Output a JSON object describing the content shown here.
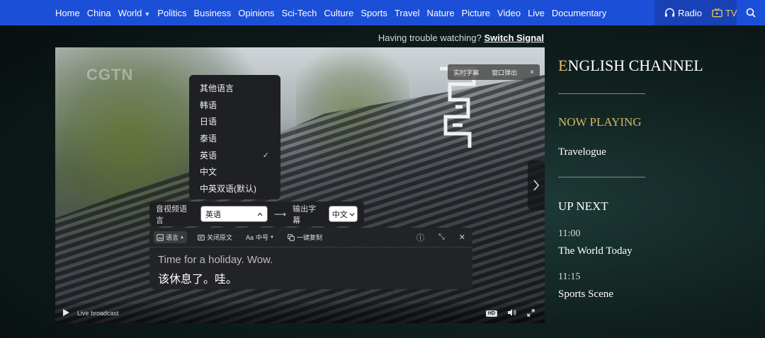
{
  "nav": {
    "items": [
      "Home",
      "China",
      "World",
      "Politics",
      "Business",
      "Opinions",
      "Sci-Tech",
      "Culture",
      "Sports",
      "Travel",
      "Nature",
      "Picture",
      "Video",
      "Live",
      "Documentary"
    ],
    "world_has_dropdown": true,
    "radio_label": "Radio",
    "tv_label": "TV",
    "search_icon": "search-icon"
  },
  "colors": {
    "nav_bg": "#1c4fd8",
    "media_bg": "#1841b6",
    "accent_gold": "#d7b661"
  },
  "trouble": {
    "text": "Having trouble watching?",
    "link": "Switch Signal"
  },
  "video": {
    "logo": "CGTN",
    "toolbar": {
      "realtime_subtitles": "实时字幕",
      "popout": "窗口弹出",
      "close": "×"
    },
    "language_menu": {
      "items": [
        "其他语言",
        "韩语",
        "日语",
        "泰语",
        "英语",
        "中文",
        "中英双语(默认)"
      ],
      "selected": "英语"
    },
    "lang_bar": {
      "source_label": "音视频语言",
      "source_value": "英语",
      "output_label": "输出字幕",
      "output_value": "中文"
    },
    "subtitle_panel": {
      "tools": {
        "language": "语言",
        "close_original": "关闭原文",
        "font_size": "中号",
        "copy": "一键复制"
      },
      "english": "Time for a holiday. Wow.",
      "chinese": "该休息了。哇。"
    },
    "controls": {
      "status": "Live broadcast",
      "hd": "HD"
    }
  },
  "side": {
    "channel_first": "E",
    "channel_rest": "NGLISH CHANNEL",
    "now_playing_head": "NOW PLAYING",
    "now_playing": "Travelogue",
    "up_next_head": "UP NEXT",
    "up_next": [
      {
        "time": "11:00",
        "title": "The World Today"
      },
      {
        "time": "11:15",
        "title": "Sports Scene"
      }
    ]
  }
}
